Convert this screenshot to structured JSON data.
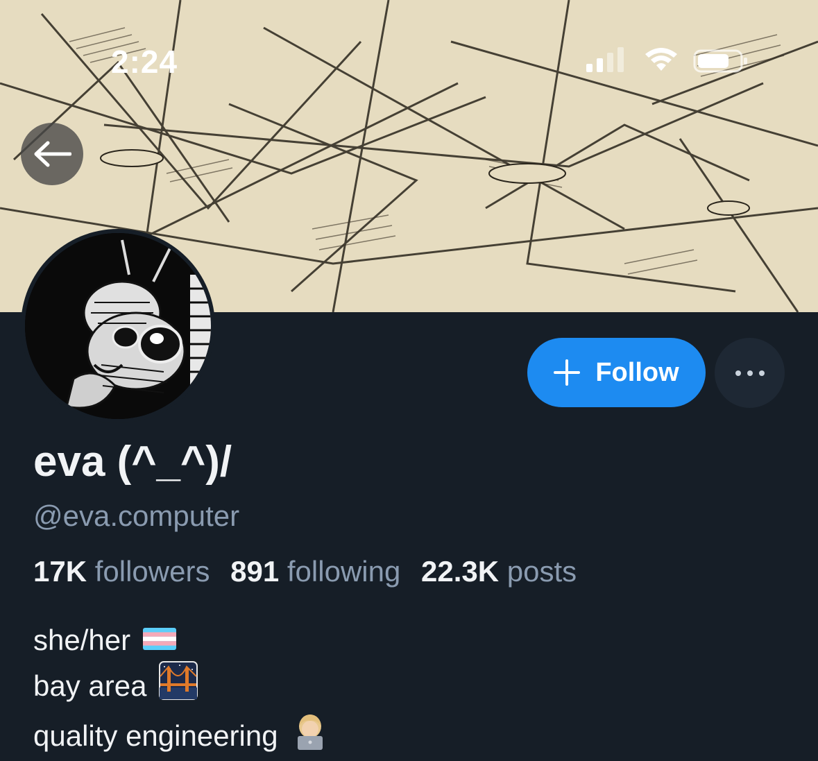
{
  "status_bar": {
    "time": "2:24",
    "icons": [
      "signal-icon",
      "wifi-icon",
      "battery-icon"
    ]
  },
  "navigation": {
    "back_icon": "arrow-left-icon"
  },
  "profile": {
    "display_name": "eva (^_^)/",
    "handle": "@eva.computer",
    "stats": {
      "followers_count": "17K",
      "followers_label": "followers",
      "following_count": "891",
      "following_label": "following",
      "posts_count": "22.3K",
      "posts_label": "posts"
    },
    "bio": [
      {
        "text": "she/her",
        "emoji": "transgender-flag-icon"
      },
      {
        "text": "bay area",
        "emoji": "golden-gate-bridge-icon"
      },
      {
        "text": "quality engineering",
        "emoji": "technologist-icon"
      }
    ]
  },
  "actions": {
    "follow_label": "Follow",
    "more_icon": "ellipsis-icon"
  },
  "colors": {
    "background": "#161e27",
    "accent": "#1d8bf1",
    "muted_text": "#8a9bb0",
    "primary_text": "#f1f3f5"
  }
}
